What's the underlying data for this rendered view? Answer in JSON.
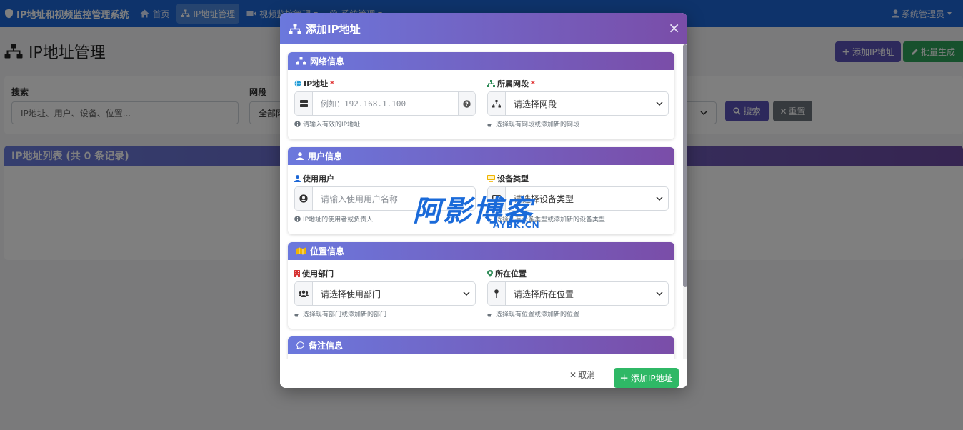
{
  "app": {
    "title": "IP地址和视频监控管理系统",
    "nav": [
      {
        "label": "首页",
        "icon": "home-icon"
      },
      {
        "label": "IP地址管理",
        "icon": "sitemap-icon"
      },
      {
        "label": "视频监控管理",
        "icon": "video-icon"
      },
      {
        "label": "系统管理",
        "icon": "gear-icon"
      }
    ],
    "user": "系统管理员"
  },
  "page": {
    "title": "IP地址管理",
    "add_button": "添加IP地址",
    "batch_button": "批量生成"
  },
  "search": {
    "keyword_label": "搜索",
    "keyword_placeholder": "IP地址、用户、设备、位置...",
    "segment_label": "网段",
    "segment_value": "全部网段",
    "search_button": "搜索",
    "reset_button": "重置"
  },
  "list": {
    "title": "IP地址列表 (共 0 条记录)"
  },
  "modal": {
    "title": "添加IP地址",
    "close": "×",
    "sections": {
      "network": {
        "title": "网络信息",
        "ip_label": "IP地址",
        "ip_placeholder": "例如：192.168.1.100",
        "ip_help": "请输入有效的IP地址",
        "segment_label": "所属网段",
        "segment_value": "请选择网段",
        "segment_help": "选择现有网段或添加新的网段",
        "required_mark": "*"
      },
      "user": {
        "title": "用户信息",
        "user_label": "使用用户",
        "user_placeholder": "请输入使用用户名称",
        "user_help": "IP地址的使用者或负责人",
        "device_label": "设备类型",
        "device_value": "请选择设备类型",
        "device_help": "选择现有设备类型或添加新的设备类型"
      },
      "location": {
        "title": "位置信息",
        "dept_label": "使用部门",
        "dept_value": "请选择使用部门",
        "dept_help": "选择现有部门或添加新的部门",
        "place_label": "所在位置",
        "place_value": "请选择所在位置",
        "place_help": "选择现有位置或添加新的位置"
      },
      "remark": {
        "title": "备注信息"
      }
    },
    "cancel": "取消",
    "submit": "添加IP地址"
  },
  "watermark": {
    "text": "阿影博客",
    "domain": "AYBK.CN"
  },
  "colors": {
    "navbar": "#1c67d6",
    "header_gradient_start": "#6b78dd",
    "header_gradient_end": "#7a4da8",
    "submit": "#2fb866",
    "watermark": "#1a6ad9"
  }
}
